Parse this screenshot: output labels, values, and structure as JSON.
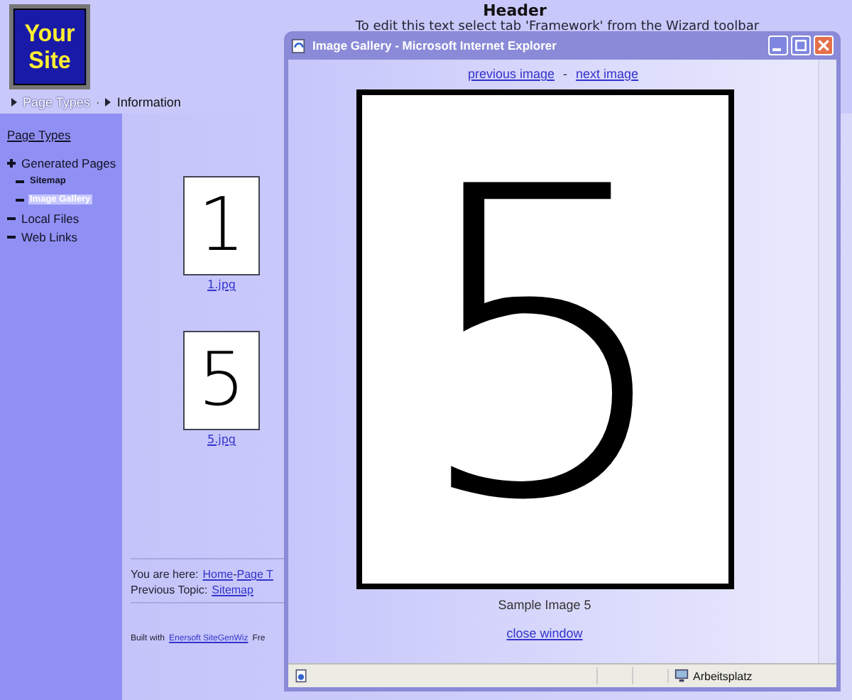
{
  "logo": {
    "lines": [
      "Your",
      "Site"
    ]
  },
  "header": {
    "title": "Header",
    "note": "To edit this text select tab 'Framework' from the Wizard toolbar"
  },
  "breadcrumb": [
    {
      "label": "Page Types",
      "link": true
    },
    {
      "label": "Information",
      "link": false
    }
  ],
  "breadcrumb_separator": "·",
  "sidebar": {
    "heading": "Page Types",
    "items": [
      {
        "label": "Generated Pages",
        "selected": false,
        "children": [
          {
            "label": "Sitemap",
            "selected": false
          },
          {
            "label": "Image Gallery",
            "selected": true
          }
        ]
      },
      {
        "label": "Local Files",
        "selected": false
      },
      {
        "label": "Web Links",
        "selected": false
      }
    ]
  },
  "thumbnails": [
    {
      "digit": "1",
      "caption": "1.jpg"
    },
    {
      "digit": "5",
      "caption": "5.jpg"
    }
  ],
  "footer": {
    "location_label": "You are here:",
    "location_links": [
      "Home",
      "Page T"
    ],
    "location_separator": "-",
    "previous_label": "Previous Topic:",
    "previous_link": "Sitemap",
    "built_label": "Built with",
    "built_link": "Enersoft SiteGenWiz",
    "built_rest": "Fre"
  },
  "popup": {
    "title": "Image Gallery - Microsoft Internet Explorer",
    "nav": [
      "previous image",
      "next image"
    ],
    "nav_separator": "-",
    "image_digit": "5",
    "caption": "Sample Image 5",
    "close_link": "close window",
    "status_zone": "Arbeitsplatz"
  }
}
